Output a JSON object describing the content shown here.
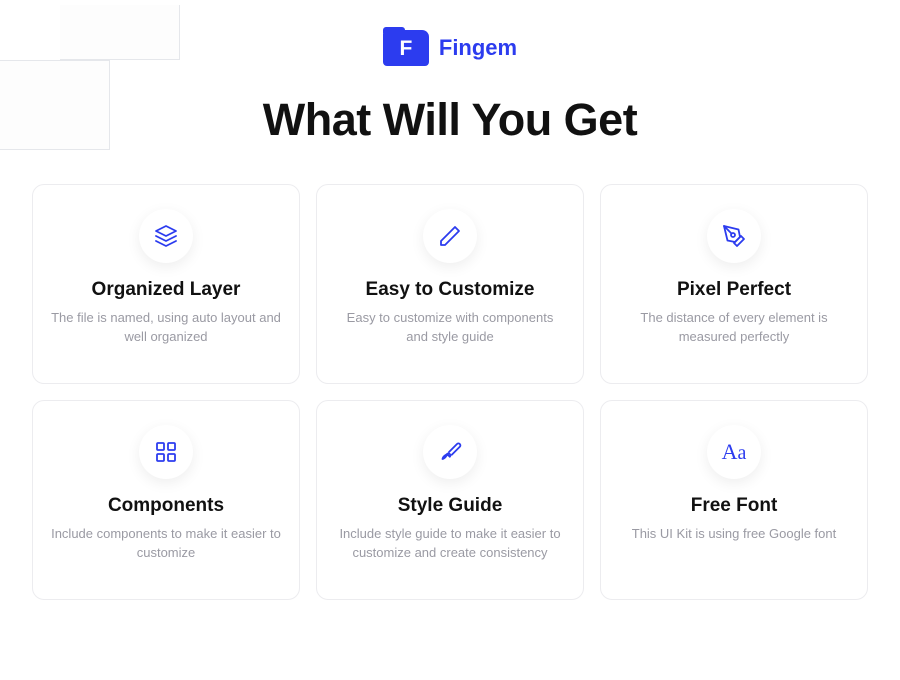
{
  "brand": {
    "name": "Fingem",
    "logo_letter": "F"
  },
  "headline": "What Will You Get",
  "cards": [
    {
      "title": "Organized Layer",
      "desc": "The file is named, using auto layout and well organized"
    },
    {
      "title": "Easy to Customize",
      "desc": "Easy to customize with components and style guide"
    },
    {
      "title": "Pixel Perfect",
      "desc": "The distance of every element is measured perfectly"
    },
    {
      "title": "Components",
      "desc": "Include components to make it easier to customize"
    },
    {
      "title": "Style Guide",
      "desc": "Include style guide to make it easier to customize and create consistency"
    },
    {
      "title": "Free Font",
      "desc": "This UI Kit is using free Google font"
    }
  ]
}
